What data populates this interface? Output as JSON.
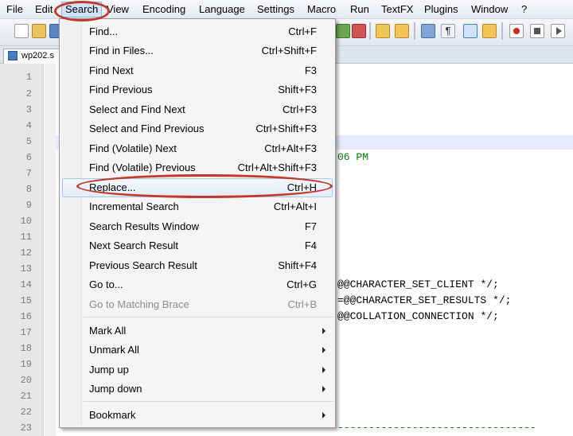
{
  "menubar": {
    "items": [
      "File",
      "Edit",
      "Search",
      "View",
      "Encoding",
      "Language",
      "Settings",
      "Macro",
      "Run",
      "TextFX",
      "Plugins",
      "Window",
      "?"
    ],
    "active_index": 2
  },
  "tab": {
    "label": "wp202.s"
  },
  "editor": {
    "line_numbers": [
      "1",
      "2",
      "3",
      "4",
      "5",
      "6",
      "7",
      "8",
      "9",
      "10",
      "11",
      "12",
      "13",
      "14",
      "15",
      "16",
      "17",
      "18",
      "19",
      "20",
      "21",
      "22",
      "23"
    ],
    "visible_code": [
      {
        "line": 6,
        "text": "06 PM",
        "color": "green"
      },
      {
        "line": 14,
        "text": "@@CHARACTER_SET_CLIENT */;"
      },
      {
        "line": 15,
        "text": "=@@CHARACTER_SET_RESULTS */;"
      },
      {
        "line": 16,
        "text": "@@COLLATION_CONNECTION */;"
      },
      {
        "line": 23,
        "text": "--------------------------------",
        "color": "green"
      }
    ]
  },
  "search_menu": {
    "items": [
      {
        "label": "Find...",
        "shortcut": "Ctrl+F"
      },
      {
        "label": "Find in Files...",
        "shortcut": "Ctrl+Shift+F"
      },
      {
        "label": "Find Next",
        "shortcut": "F3"
      },
      {
        "label": "Find Previous",
        "shortcut": "Shift+F3"
      },
      {
        "label": "Select and Find Next",
        "shortcut": "Ctrl+F3"
      },
      {
        "label": "Select and Find Previous",
        "shortcut": "Ctrl+Shift+F3"
      },
      {
        "label": "Find (Volatile) Next",
        "shortcut": "Ctrl+Alt+F3"
      },
      {
        "label": "Find (Volatile) Previous",
        "shortcut": "Ctrl+Alt+Shift+F3"
      },
      {
        "label": "Replace...",
        "shortcut": "Ctrl+H",
        "highlighted": true
      },
      {
        "label": "Incremental Search",
        "shortcut": "Ctrl+Alt+I"
      },
      {
        "label": "Search Results Window",
        "shortcut": "F7"
      },
      {
        "label": "Next Search Result",
        "shortcut": "F4"
      },
      {
        "label": "Previous Search Result",
        "shortcut": "Shift+F4"
      },
      {
        "label": "Go to...",
        "shortcut": "Ctrl+G"
      },
      {
        "label": "Go to Matching Brace",
        "shortcut": "Ctrl+B",
        "disabled": true
      },
      {
        "label": "Mark All",
        "submenu": true
      },
      {
        "label": "Unmark All",
        "submenu": true
      },
      {
        "label": "Jump up",
        "submenu": true
      },
      {
        "label": "Jump down",
        "submenu": true
      },
      {
        "label": "Bookmark",
        "submenu": true
      }
    ]
  },
  "colors": {
    "callout": "#c0392b",
    "menu_highlight": "#cfe3f7",
    "comment_green": "#008000"
  }
}
